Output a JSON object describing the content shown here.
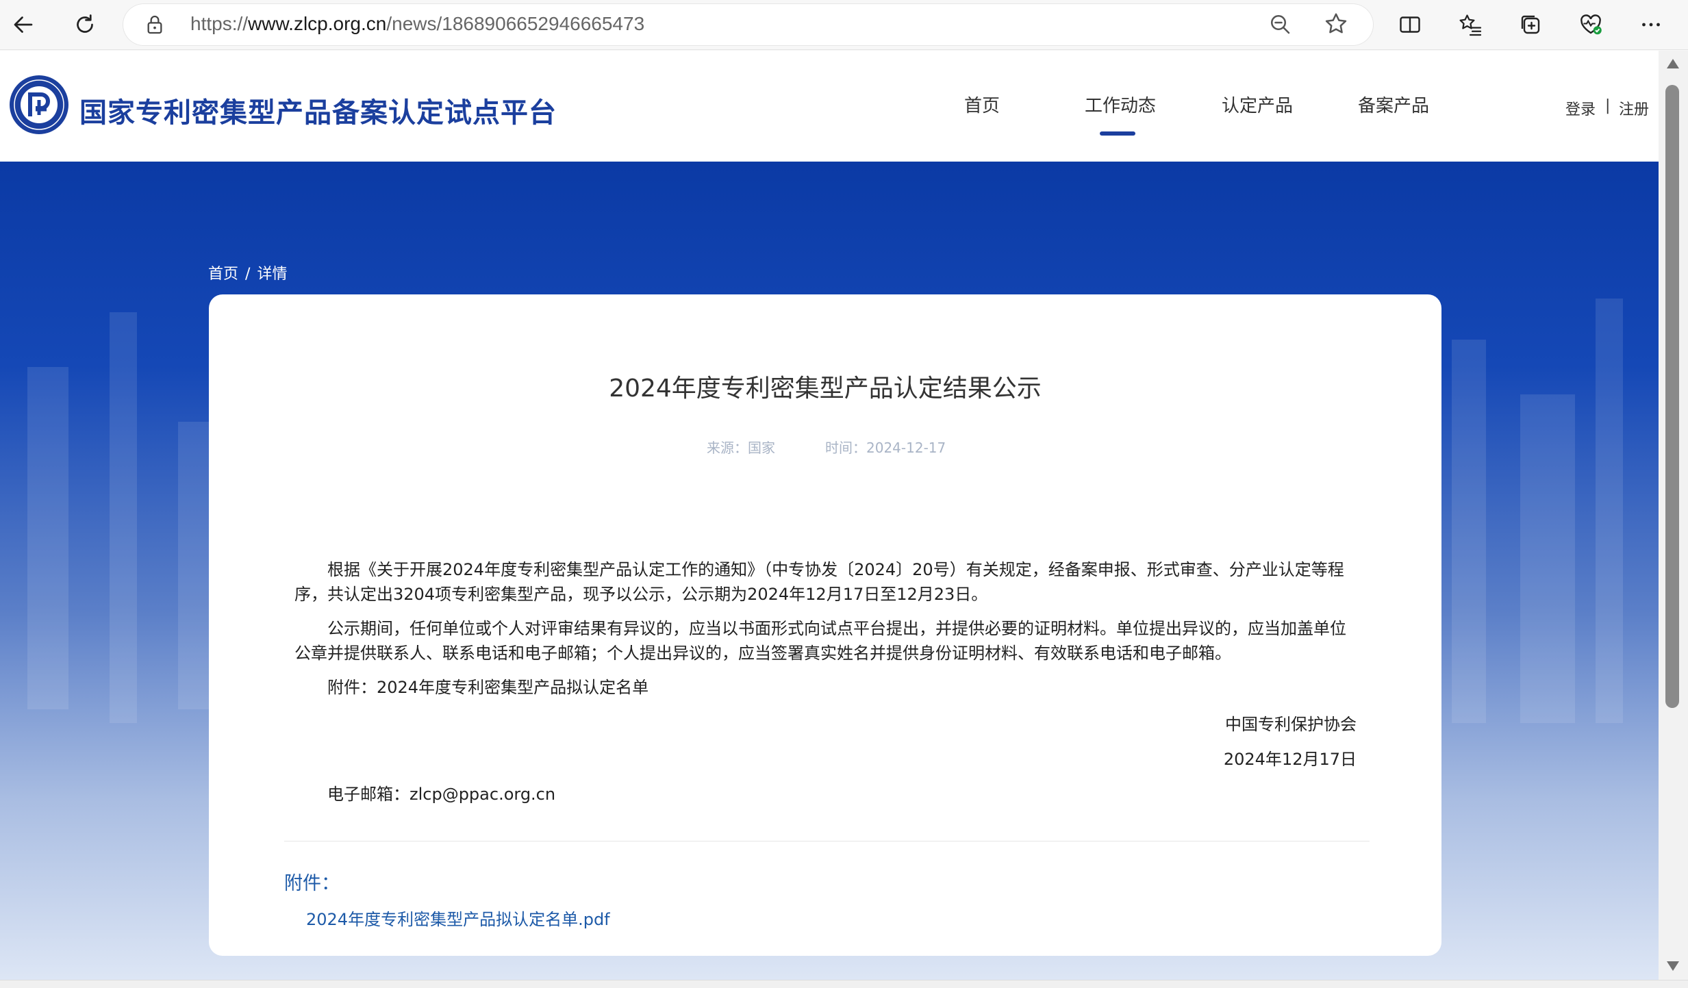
{
  "browser": {
    "url_scheme": "https://",
    "url_host": "www.zlcp.org.cn",
    "url_path": "/news/1868906652946665473"
  },
  "site": {
    "title": "国家专利密集型产品备案认定试点平台",
    "brand_color": "#1b3f9e"
  },
  "nav": {
    "items": [
      "首页",
      "工作动态",
      "认定产品",
      "备案产品"
    ],
    "active": "工作动态"
  },
  "auth": {
    "login": "登录",
    "separator": "|",
    "register": "注册"
  },
  "breadcrumb": {
    "home": "首页",
    "separator": "/",
    "current": "详情"
  },
  "article": {
    "title": "2024年度专利密集型产品认定结果公示",
    "source": "来源：国家",
    "time": "时间：2024-12-17",
    "paragraphs": [
      "根据《关于开展2024年度专利密集型产品认定工作的通知》（中专协发〔2024〕20号）有关规定，经备案申报、形式审查、分产业认定等程序，共认定出3204项专利密集型产品，现予以公示，公示期为2024年12月17日至12月23日。",
      "公示期间，任何单位或个人对评审结果有异议的，应当以书面形式向试点平台提出，并提供必要的证明材料。单位提出异议的，应当加盖单位公章并提供联系人、联系电话和电子邮箱；个人提出异议的，应当签署真实姓名并提供身份证明材料、有效联系电话和电子邮箱。",
      "附件：2024年度专利密集型产品拟认定名单"
    ],
    "signature_org": "中国专利保护协会",
    "signature_date": "2024年12月17日",
    "email": "电子邮箱：zlcp@ppac.org.cn"
  },
  "attachments": {
    "label": "附件：",
    "files": [
      "2024年度专利密集型产品拟认定名单.pdf"
    ],
    "link_color": "#1d5aa8"
  }
}
